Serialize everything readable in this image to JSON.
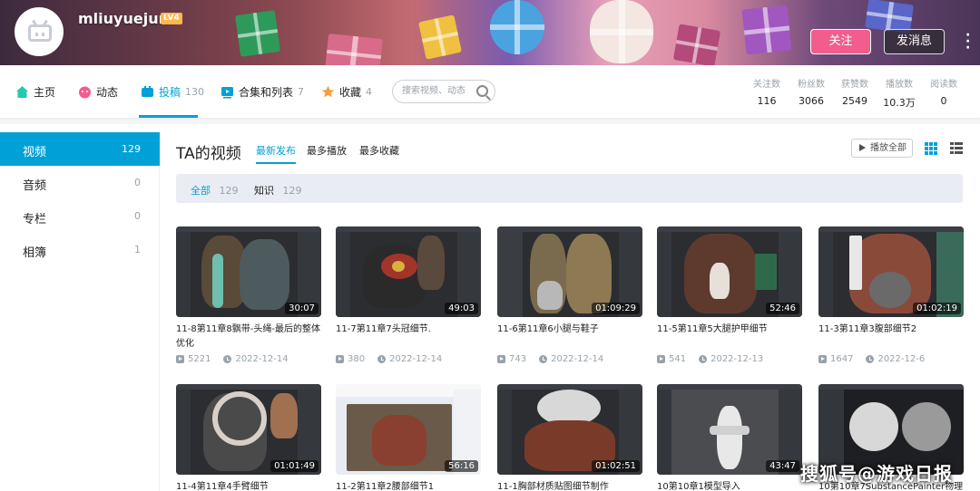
{
  "header": {
    "username": "mliuyuejun",
    "level_badge": "LV4",
    "follow_label": "关注",
    "message_label": "发消息"
  },
  "nav": {
    "tabs": [
      {
        "label": "主页",
        "count": "",
        "icon": "home-icon",
        "color": "#23c9b0"
      },
      {
        "label": "动态",
        "count": "",
        "icon": "dynamic-icon",
        "color": "#f25d8e"
      },
      {
        "label": "投稿",
        "count": "130",
        "icon": "upload-icon",
        "color": "#00a1d6"
      },
      {
        "label": "合集和列表",
        "count": "7",
        "icon": "collection-icon",
        "color": "#00a1d6"
      },
      {
        "label": "收藏",
        "count": "4",
        "icon": "favorite-icon",
        "color": "#fb9a3c"
      }
    ],
    "search_placeholder": "搜索视频、动态",
    "stats": [
      {
        "label": "关注数",
        "value": "116"
      },
      {
        "label": "粉丝数",
        "value": "3066"
      },
      {
        "label": "获赞数",
        "value": "2549"
      },
      {
        "label": "播放数",
        "value": "10.3万"
      },
      {
        "label": "阅读数",
        "value": "0"
      }
    ]
  },
  "sidebar": {
    "items": [
      {
        "label": "视频",
        "count": "129"
      },
      {
        "label": "音频",
        "count": "0"
      },
      {
        "label": "专栏",
        "count": "0"
      },
      {
        "label": "相簿",
        "count": "1"
      }
    ]
  },
  "content": {
    "title": "TA的视频",
    "sort_tabs": [
      "最新发布",
      "最多播放",
      "最多收藏"
    ],
    "play_all_label": "播放全部",
    "filters": [
      {
        "label": "全部",
        "count": "129"
      },
      {
        "label": "知识",
        "count": "129"
      }
    ]
  },
  "videos": [
    {
      "title": "11-8第11章8飘带-头绳-最后的整体优化",
      "duration": "30:07",
      "plays": "5221",
      "date": "2022-12-14"
    },
    {
      "title": "11-7第11章7头冠细节.",
      "duration": "49:03",
      "plays": "380",
      "date": "2022-12-14"
    },
    {
      "title": "11-6第11章6小腿与鞋子",
      "duration": "01:09:29",
      "plays": "743",
      "date": "2022-12-14"
    },
    {
      "title": "11-5第11章5大腿护甲细节",
      "duration": "52:46",
      "plays": "541",
      "date": "2022-12-13"
    },
    {
      "title": "11-3第11章3腹部细节2",
      "duration": "01:02:19",
      "plays": "1647",
      "date": "2022-12-6"
    },
    {
      "title": "11-4第11章4手臂细节",
      "duration": "01:01:49",
      "plays": "",
      "date": ""
    },
    {
      "title": "11-2第11章2腰部细节1",
      "duration": "56:16",
      "plays": "",
      "date": ""
    },
    {
      "title": "11-1胸部材质贴图细节制作",
      "duration": "01:02:51",
      "plays": "",
      "date": ""
    },
    {
      "title": "10第10章1模型导入",
      "duration": "43:47",
      "plays": "",
      "date": ""
    },
    {
      "title": "10第10章7SubstancePainter物理",
      "duration": "",
      "plays": "",
      "date": ""
    }
  ],
  "watermark": "搜狐号@游戏日报",
  "colors": {
    "accent": "#00a1d6",
    "follow": "#f25d8e"
  }
}
